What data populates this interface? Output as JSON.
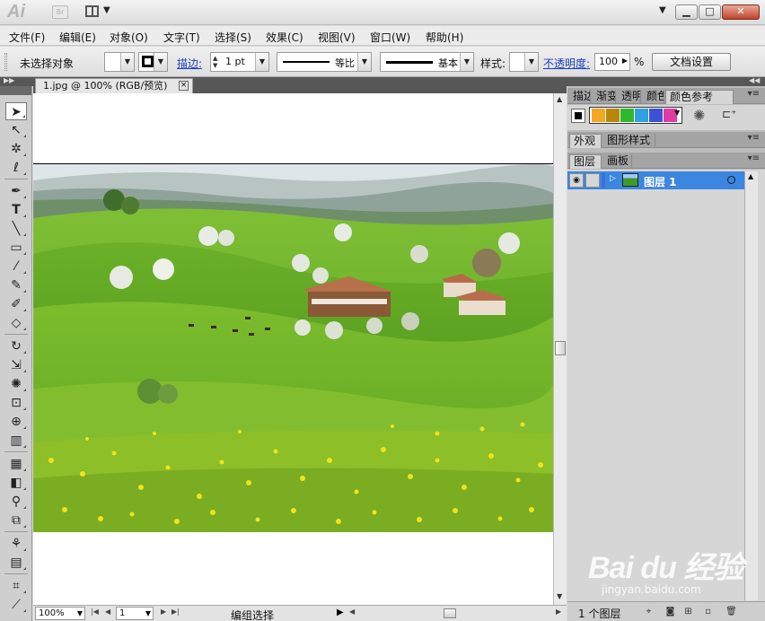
{
  "titlebar": {
    "app_logo": "Ai",
    "bridge_label": "Br",
    "arrange_icon": "arrange-documents-icon",
    "workspace_dropdown": "▼",
    "min_label": "▁",
    "max_label": "□",
    "close_label": "✕"
  },
  "menu": {
    "items": [
      "文件(F)",
      "编辑(E)",
      "对象(O)",
      "文字(T)",
      "选择(S)",
      "效果(C)",
      "视图(V)",
      "窗口(W)",
      "帮助(H)"
    ]
  },
  "control": {
    "selection_status": "未选择对象",
    "stroke_label": "描边:",
    "stroke_weight": "1 pt",
    "profile_label": "等比",
    "brush_label": "基本",
    "style_label": "样式:",
    "opacity_label": "不透明度:",
    "opacity_value": "100",
    "opacity_unit": "%",
    "doc_setup": "文档设置"
  },
  "document": {
    "tab_title": "1.jpg @ 100% (RGB/预览)",
    "close_icon": "×"
  },
  "statusbar": {
    "zoom": "100%",
    "artboard_number": "1",
    "mode": "编组选择"
  },
  "panels": {
    "top_tabs": [
      "描边",
      "渐变",
      "透明",
      "颜色",
      "颜色参考"
    ],
    "top_active": "颜色参考",
    "guide_colors": [
      "#f5a623",
      "#b8860b",
      "#2db82d",
      "#2fa0e0",
      "#3c52d6",
      "#e03aa3"
    ],
    "appearance_tabs": [
      "外观",
      "图形样式"
    ],
    "layers_tabs": [
      "图层",
      "画板"
    ],
    "layer_name": "图层 1",
    "layers_count": "1 个图层"
  },
  "watermark": {
    "brand": "Bai du 经验",
    "url": "jingyan.baidu.com"
  }
}
